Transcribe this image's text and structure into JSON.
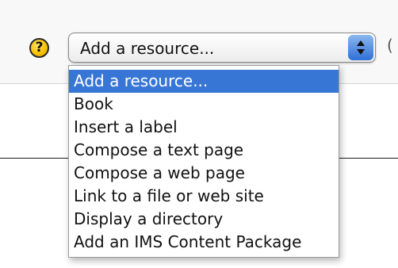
{
  "help": {
    "icon": "question-mark-icon",
    "symbol": "?"
  },
  "select": {
    "current_value": "Add a resource...",
    "arrow_icon": "updown-arrows-icon"
  },
  "edge_text": "(",
  "options": [
    {
      "label": "Add a resource..."
    },
    {
      "label": "Book"
    },
    {
      "label": "Insert a label"
    },
    {
      "label": "Compose a text page"
    },
    {
      "label": "Compose a web page"
    },
    {
      "label": "Link to a file or web site"
    },
    {
      "label": "Display a directory"
    },
    {
      "label": "Add an IMS Content Package"
    }
  ],
  "colors": {
    "highlight": "#3876d6",
    "help_icon": "#f7c300",
    "arrow_button": "#2f6fd6"
  }
}
